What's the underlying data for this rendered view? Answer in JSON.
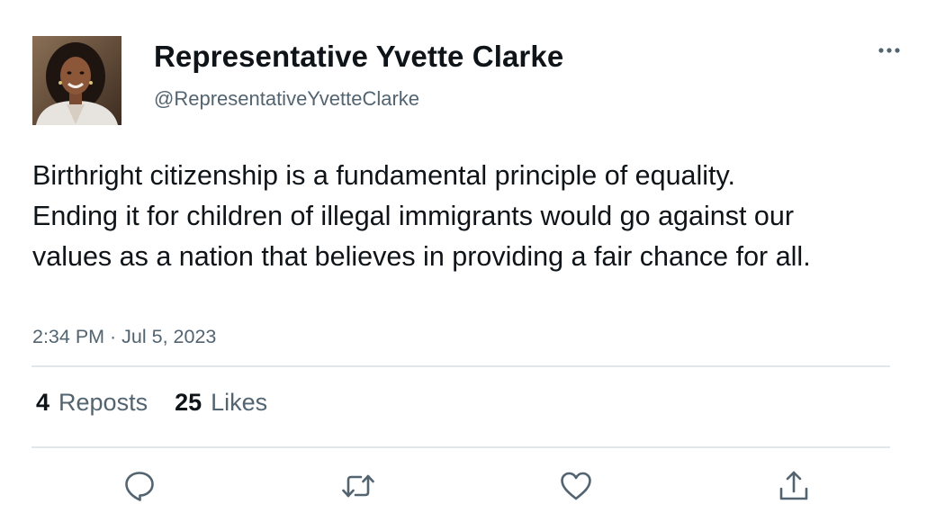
{
  "tweet": {
    "author": {
      "display_name": "Representative Yvette Clarke",
      "handle": "@RepresentativeYvetteClarke"
    },
    "text": "Birthright citizenship is a fundamental principle of equality. Ending it for children of illegal immigrants would go against our values as a nation that believes in providing a fair chance for all.",
    "timestamp": "2:34 PM · Jul 5, 2023",
    "stats": {
      "reposts_count": "4",
      "reposts_label": "Reposts",
      "likes_count": "25",
      "likes_label": "Likes"
    },
    "actions": {
      "reply_icon": "speech-bubble-icon",
      "repost_icon": "repost-arrows-icon",
      "like_icon": "heart-icon",
      "share_icon": "share-upload-icon"
    }
  },
  "colors": {
    "primary_text": "#0f1419",
    "secondary_text": "#536471",
    "icon_gray": "#536471",
    "divider": "#e3e6e8"
  }
}
